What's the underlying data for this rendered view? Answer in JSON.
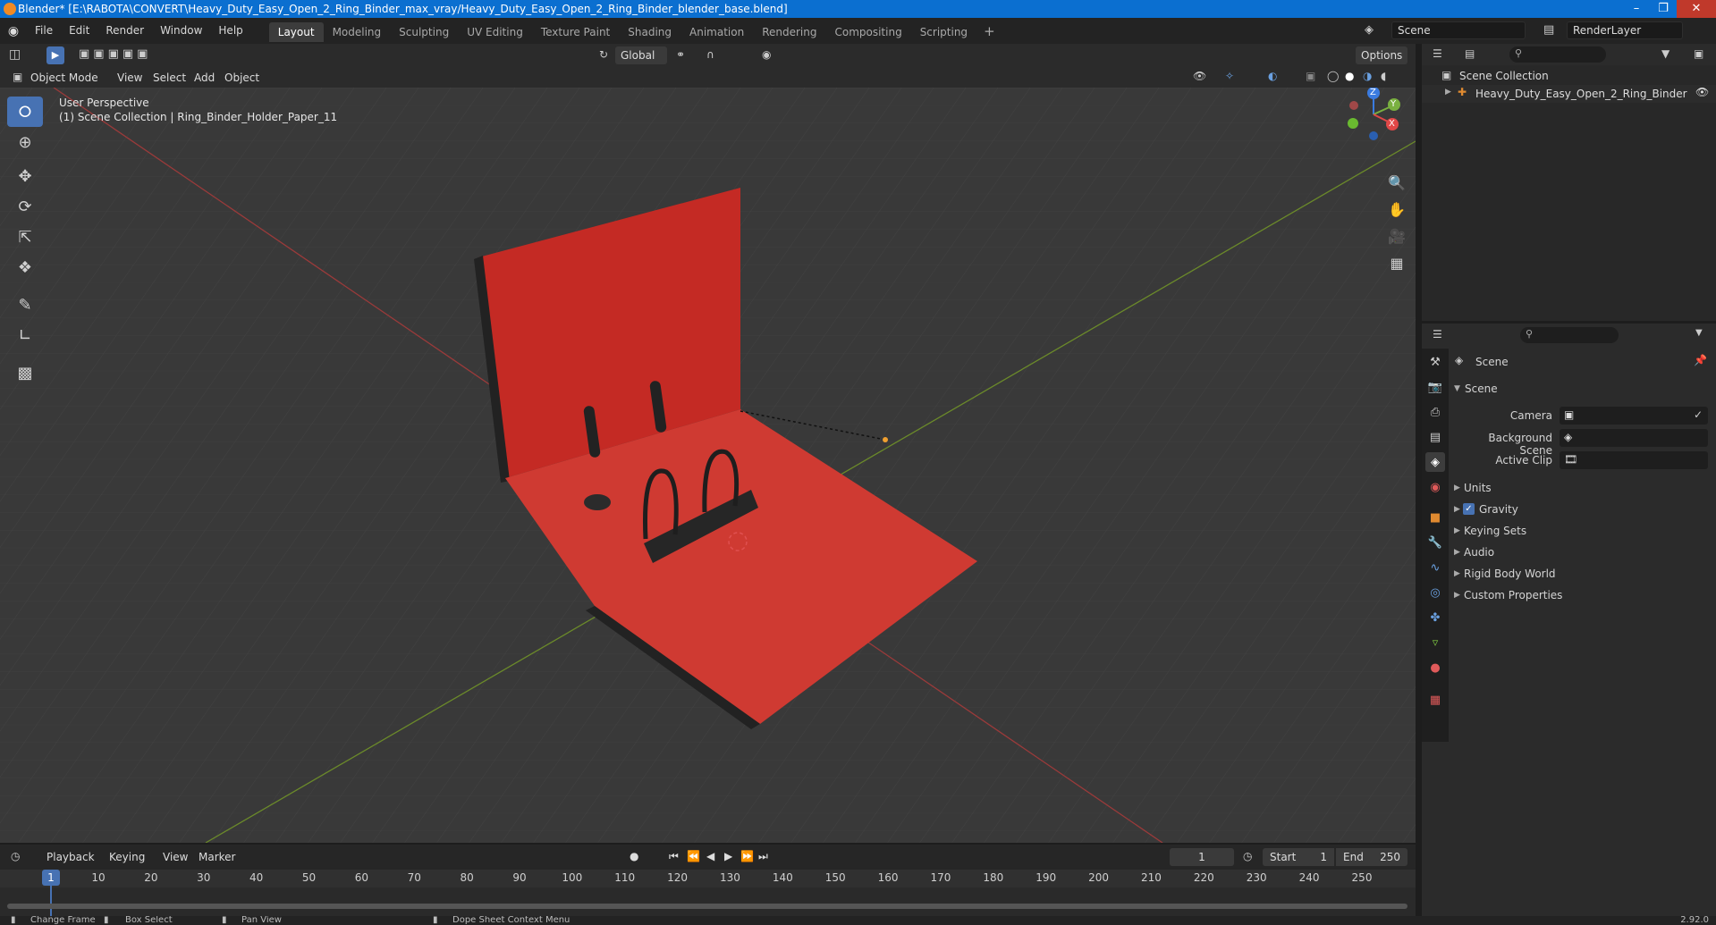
{
  "titlebar": {
    "text": "Blender* [E:\\RABOTA\\CONVERT\\Heavy_Duty_Easy_Open_2_Ring_Binder_max_vray/Heavy_Duty_Easy_Open_2_Ring_Binder_blender_base.blend]"
  },
  "menu": [
    "File",
    "Edit",
    "Render",
    "Window",
    "Help"
  ],
  "workspaces": [
    "Layout",
    "Modeling",
    "Sculpting",
    "UV Editing",
    "Texture Paint",
    "Shading",
    "Animation",
    "Rendering",
    "Compositing",
    "Scripting"
  ],
  "active_workspace": "Layout",
  "scene_field": "Scene",
  "viewlayer_field": "RenderLayer",
  "viewport_header": {
    "mode": "Object Mode",
    "menus": [
      "View",
      "Select",
      "Add",
      "Object"
    ],
    "orientation": "Global",
    "options": "Options"
  },
  "viewport": {
    "perspective": "User Perspective",
    "collection_info": "(1) Scene Collection | Ring_Binder_Holder_Paper_11",
    "gizmo_axes": [
      "Z",
      "Y",
      "X"
    ]
  },
  "outliner": {
    "root": "Scene Collection",
    "items": [
      {
        "name": "Heavy_Duty_Easy_Open_2_Ring_Binder"
      }
    ]
  },
  "properties": {
    "context": "Scene",
    "panel": "Scene",
    "fields": [
      {
        "label": "Camera"
      },
      {
        "label": "Background Scene"
      },
      {
        "label": "Active Clip"
      }
    ],
    "sections": [
      "Units",
      "Gravity",
      "Keying Sets",
      "Audio",
      "Rigid Body World",
      "Custom Properties"
    ],
    "gravity_checked": true
  },
  "timeline": {
    "menus": [
      "Playback",
      "Keying",
      "View",
      "Marker"
    ],
    "current_frame": "1",
    "start_label": "Start",
    "start": "1",
    "end_label": "End",
    "end": "250",
    "ticks": [
      "1",
      "10",
      "20",
      "30",
      "40",
      "50",
      "60",
      "70",
      "80",
      "90",
      "100",
      "110",
      "120",
      "130",
      "140",
      "150",
      "160",
      "170",
      "180",
      "190",
      "200",
      "210",
      "220",
      "230",
      "240",
      "250"
    ]
  },
  "statusbar": {
    "items": [
      "Change Frame",
      "Box Select",
      "Pan View",
      "Dope Sheet Context Menu"
    ],
    "version": "2.92.0"
  },
  "colors": {
    "accent": "#4772b3",
    "binder_red": "#c8302b",
    "grid_bg": "#393939"
  }
}
